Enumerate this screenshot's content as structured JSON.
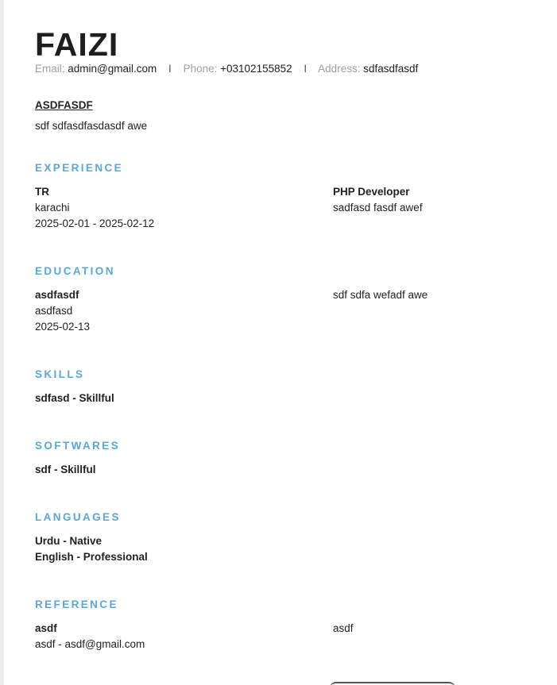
{
  "resume": {
    "name": "FAIZI",
    "contact": {
      "email_label": "Email:",
      "email": "admin@gmail.com",
      "phone_label": "Phone:",
      "phone": "+03102155852",
      "address_label": "Address:",
      "address": "sdfasdfasdf",
      "separator": "I"
    },
    "summary": {
      "title": "ASDFASDF",
      "text": "sdf sdfasdfasdasdf awe"
    },
    "experience": {
      "title": "EXPERIENCE",
      "company": "TR",
      "location": "karachi",
      "dates": "2025-02-01 - 2025-02-12",
      "role": "PHP Developer",
      "description": "sadfasd fasdf awef"
    },
    "education": {
      "title": "EDUCATION",
      "degree": "asdfasdf",
      "institute": "asdfasd",
      "date": "2025-02-13",
      "description": "sdf sdfa wefadf awe"
    },
    "skills": {
      "title": "SKILLS",
      "items": [
        "sdfasd - Skillful"
      ]
    },
    "softwares": {
      "title": "SOFTWARES",
      "items": [
        "sdf - Skillful"
      ]
    },
    "languages": {
      "title": "LANGUAGES",
      "items": [
        "Urdu - Native",
        "English - Professional"
      ]
    },
    "reference": {
      "title": "REFERENCE",
      "name": "asdf",
      "contact": "asdf - asdf@gmail.com",
      "note": "asdf"
    },
    "colors": {
      "accent": "#58a8d9",
      "text": "#222222",
      "muted_label": "#a0a0a0"
    }
  }
}
